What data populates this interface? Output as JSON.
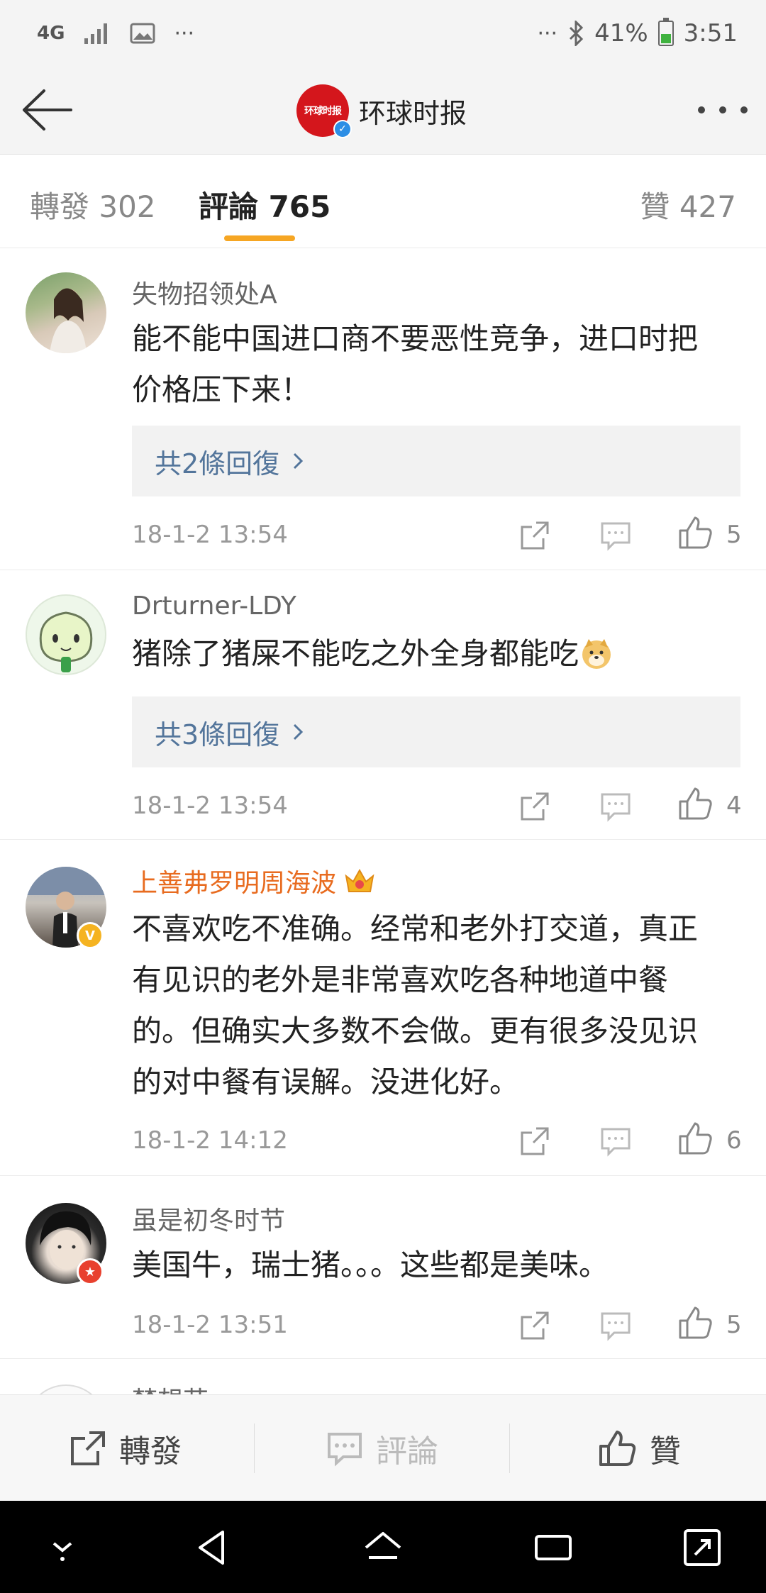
{
  "status_bar": {
    "network": "4G",
    "notifications": "···",
    "more": "···",
    "battery": "41%",
    "time": "3:51",
    "battery_level": 0.41
  },
  "nav": {
    "title": "环球时报",
    "logo_text": "环球时报",
    "verified_mark": "✓"
  },
  "tabs": [
    {
      "label": "轉發 302"
    },
    {
      "label": "評論 765"
    },
    {
      "label": "贊 427"
    }
  ],
  "active_tab": 1,
  "comments": [
    {
      "username": "失物招领处A",
      "lines": [
        "能不能中国进口商不要恶性竞争，进口时把",
        "价格压下来！"
      ],
      "replies": "共2條回復",
      "time": "18-1-2 13:54",
      "likes": "5"
    },
    {
      "username": "Drturner-LDY",
      "lines": [
        "猪除了猪屎不能吃之外全身都能吃"
      ],
      "replies": "共3條回復",
      "time": "18-1-2 13:54",
      "likes": "4"
    },
    {
      "username": "上善弗罗明周海波",
      "lines": [
        "不喜欢吃不准确。经常和老外打交道，真正",
        "有见识的老外是非常喜欢吃各种地道中餐",
        "的。但确实大多数不会做。更有很多没见识",
        "的对中餐有误解。没进化好。"
      ],
      "badge": "V",
      "time": "18-1-2 14:12",
      "likes": "6"
    },
    {
      "username": "虽是初冬时节",
      "lines": [
        "美国牛，瑞士猪。。。这些都是美味。"
      ],
      "badge": "★",
      "time": "18-1-2 13:51",
      "likes": "5"
    }
  ],
  "partial_username": "梦想花",
  "bottom_bar": {
    "repost": "轉發",
    "comment": "評論",
    "like": "贊"
  },
  "colors": {
    "accent": "#f6a623",
    "link": "#53759b",
    "vip_name": "#e86b1f",
    "brand_red": "#d4161c"
  }
}
